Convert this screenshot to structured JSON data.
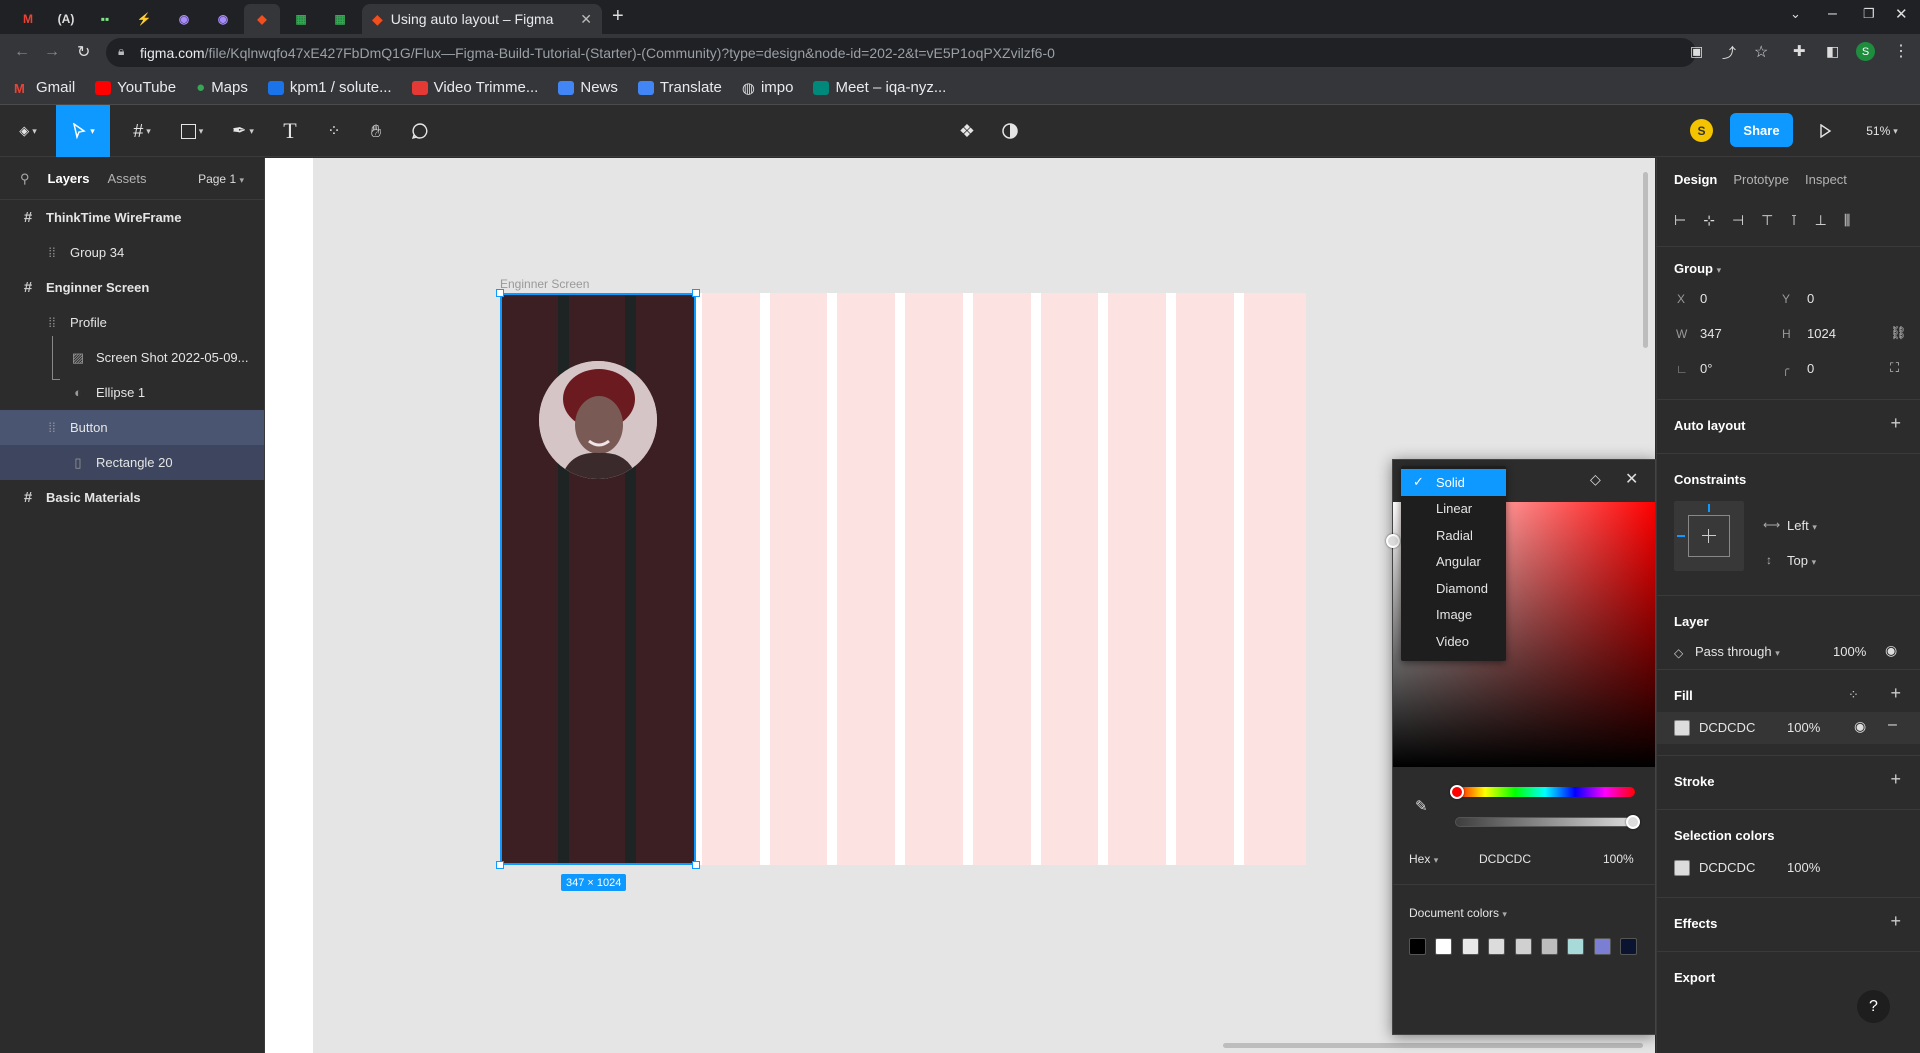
{
  "browser": {
    "active_tab_title": "Using auto layout – Figma",
    "url_domain": "figma.com",
    "url_path": "/file/Kqlnwqfo47xE427FbDmQ1G/Flux—Figma-Build-Tutorial-(Starter)-(Community)?type=design&node-id=202-2&t=vE5P1oqPXZvilzf6-0",
    "profile_initial": "S",
    "bookmarks": [
      "Gmail",
      "YouTube",
      "Maps",
      "kpm1 / solute...",
      "Video Trimme...",
      "News",
      "Translate",
      "impo",
      "Meet – iqa-nyz..."
    ]
  },
  "toolbar": {
    "share_label": "Share",
    "zoom": "51%",
    "avatar_initial": "S"
  },
  "left_panel": {
    "tabs": [
      "Layers",
      "Assets"
    ],
    "page": "Page 1",
    "layers": [
      {
        "label": "ThinkTime WireFrame",
        "type": "frame"
      },
      {
        "label": "Group 34",
        "type": "group"
      },
      {
        "label": "Enginner Screen",
        "type": "frame"
      },
      {
        "label": "Profile",
        "type": "group"
      },
      {
        "label": "Screen Shot 2022-05-09...",
        "type": "image"
      },
      {
        "label": "Ellipse 1",
        "type": "ellipse"
      },
      {
        "label": "Button",
        "type": "group"
      },
      {
        "label": "Rectangle 20",
        "type": "rect"
      },
      {
        "label": "Basic Materials",
        "type": "frame"
      }
    ]
  },
  "canvas": {
    "frame_label": "Enginner Screen",
    "size_badge": "347 × 1024"
  },
  "color_picker": {
    "fill_types": [
      "Solid",
      "Linear",
      "Radial",
      "Angular",
      "Diamond",
      "Image",
      "Video"
    ],
    "selected_type": "Solid",
    "mode": "Hex",
    "hex": "DCDCDC",
    "opacity": "100%",
    "document_colors_label": "Document colors",
    "document_colors": [
      "#000000",
      "#ffffff",
      "#e8e8e8",
      "#dcdcdc",
      "#d0d0d0",
      "#bdbdbd",
      "#a9dada",
      "#7b7fd4",
      "#0a1430"
    ]
  },
  "right_panel": {
    "tabs": [
      "Design",
      "Prototype",
      "Inspect"
    ],
    "group": {
      "title": "Group",
      "x_label": "X",
      "x": "0",
      "y_label": "Y",
      "y": "0",
      "w_label": "W",
      "w": "347",
      "h_label": "H",
      "h": "1024",
      "rotation": "0°",
      "radius": "0"
    },
    "auto_layout": "Auto layout",
    "constraints": {
      "title": "Constraints",
      "horizontal": "Left",
      "vertical": "Top"
    },
    "layer": {
      "title": "Layer",
      "blend": "Pass through",
      "opacity": "100%"
    },
    "fill": {
      "title": "Fill",
      "hex": "DCDCDC",
      "opacity": "100%"
    },
    "stroke": "Stroke",
    "selection_colors": {
      "title": "Selection colors",
      "hex": "DCDCDC",
      "opacity": "100%"
    },
    "effects": "Effects",
    "export": "Export",
    "help": "?"
  }
}
